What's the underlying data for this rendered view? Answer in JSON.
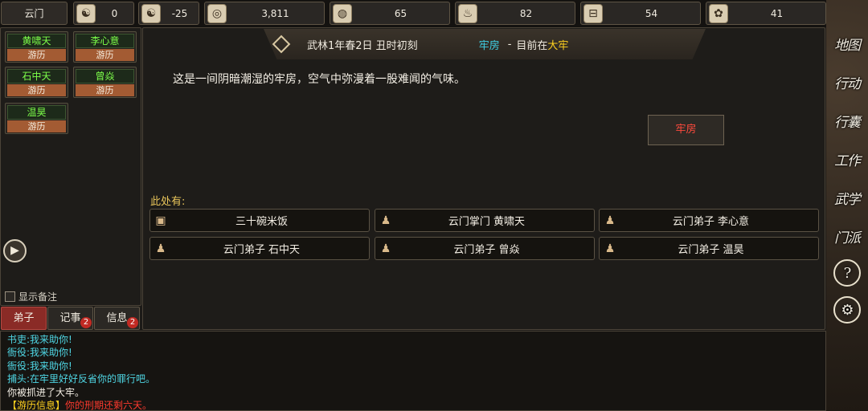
{
  "resources": {
    "sect": "云门",
    "items": [
      {
        "icon": "prestige-icon",
        "glyph": "☯",
        "value": "0"
      },
      {
        "icon": "yinyang-icon",
        "glyph": "☯",
        "value": "-25"
      },
      {
        "icon": "coin-icon",
        "glyph": "◎",
        "value": "3,811"
      },
      {
        "icon": "food-bowl-icon",
        "glyph": "◍",
        "value": "65"
      },
      {
        "icon": "wine-bottle-icon",
        "glyph": "♨",
        "value": "82"
      },
      {
        "icon": "wood-icon",
        "glyph": "⊟",
        "value": "54"
      },
      {
        "icon": "herb-icon",
        "glyph": "✿",
        "value": "41"
      }
    ]
  },
  "disciples": [
    {
      "name": "黄啸天",
      "status": "游历"
    },
    {
      "name": "李心意",
      "status": "游历"
    },
    {
      "name": "石中天",
      "status": "游历"
    },
    {
      "name": "曾焱",
      "status": "游历"
    },
    {
      "name": "温昊",
      "status": "游历"
    }
  ],
  "left": {
    "notes_label": "显示备注",
    "tabs": [
      {
        "label": "弟子",
        "badge": ""
      },
      {
        "label": "记事",
        "badge": "2"
      },
      {
        "label": "信息",
        "badge": "2"
      }
    ]
  },
  "header": {
    "date": "武林1年春2日 丑时初刻",
    "location": "牢房",
    "separator": "-",
    "where_prefix": "目前在",
    "where_value": "大牢"
  },
  "main": {
    "description": "这是一间阴暗潮湿的牢房，空气中弥漫着一股难闻的气味。",
    "location_button": "牢房",
    "here_label": "此处有:",
    "items": [
      {
        "icon": "food-box-icon",
        "label": "三十碗米饭"
      },
      {
        "icon": "person-icon",
        "label": "云门掌门  黄啸天"
      },
      {
        "icon": "person-icon",
        "label": "云门弟子  李心意"
      },
      {
        "icon": "person-icon",
        "label": "云门弟子  石中天"
      },
      {
        "icon": "person-icon",
        "label": "云门弟子  曾焱"
      },
      {
        "icon": "person-icon",
        "label": "云门弟子  温昊"
      }
    ]
  },
  "side_menu": [
    {
      "label": "地图"
    },
    {
      "label": "行动"
    },
    {
      "label": "行囊"
    },
    {
      "label": "工作"
    },
    {
      "label": "武学"
    },
    {
      "label": "门派"
    },
    {
      "label": "?"
    },
    {
      "label": "⚙"
    }
  ],
  "log": [
    {
      "speaker": "书吏:",
      "text": "我来助你!",
      "kind": "speech"
    },
    {
      "speaker": "衙役:",
      "text": "我来助你!",
      "kind": "speech"
    },
    {
      "speaker": "衙役:",
      "text": "我来助你!",
      "kind": "speech"
    },
    {
      "speaker": "捕头:",
      "text": "在牢里好好反省你的罪行吧。",
      "kind": "speech"
    },
    {
      "speaker": "",
      "text": "你被抓进了大牢。",
      "kind": "plain"
    },
    {
      "speaker": "【游历信息】",
      "text": "你的刑期还剩六天。",
      "kind": "alert"
    }
  ]
}
